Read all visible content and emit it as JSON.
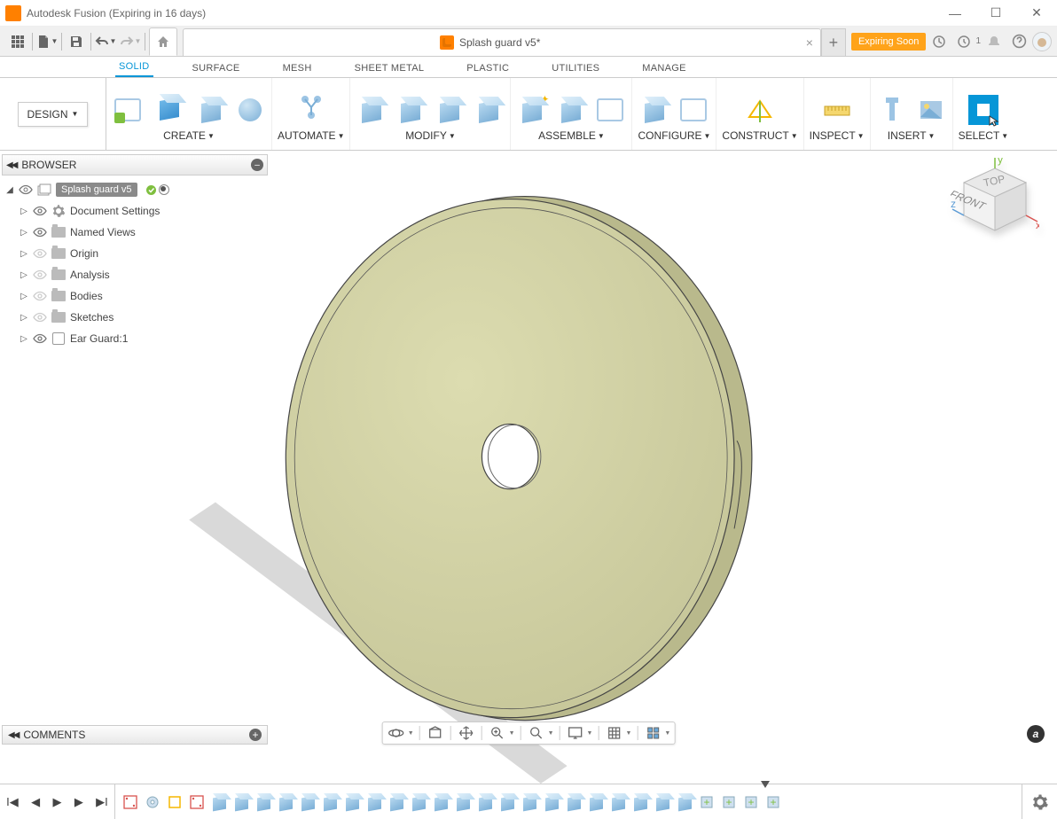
{
  "app": {
    "title": "Autodesk Fusion (Expiring in 16 days)"
  },
  "tabs": {
    "document_name": "Splash guard v5*",
    "expiring_label": "Expiring Soon",
    "job_count": "1"
  },
  "workspace": {
    "button_label": "DESIGN",
    "tabs": [
      "SOLID",
      "SURFACE",
      "MESH",
      "SHEET METAL",
      "PLASTIC",
      "UTILITIES",
      "MANAGE"
    ],
    "active_index": 0
  },
  "ribbon_groups": {
    "create": "CREATE",
    "automate": "AUTOMATE",
    "modify": "MODIFY",
    "assemble": "ASSEMBLE",
    "configure": "CONFIGURE",
    "construct": "CONSTRUCT",
    "inspect": "INSPECT",
    "insert": "INSERT",
    "select": "SELECT"
  },
  "browser": {
    "title": "BROWSER",
    "root": "Splash guard v5",
    "items": [
      {
        "label": "Document Settings",
        "icon": "gear",
        "visible": true
      },
      {
        "label": "Named Views",
        "icon": "folder",
        "visible": true
      },
      {
        "label": "Origin",
        "icon": "folder",
        "visible": false
      },
      {
        "label": "Analysis",
        "icon": "folder",
        "visible": false
      },
      {
        "label": "Bodies",
        "icon": "folder",
        "visible": false
      },
      {
        "label": "Sketches",
        "icon": "folder",
        "visible": false
      },
      {
        "label": "Ear Guard:1",
        "icon": "component",
        "visible": true
      }
    ]
  },
  "comments": {
    "title": "COMMENTS"
  },
  "viewcube": {
    "front": "FRONT",
    "top": "TOP",
    "axes": [
      "x",
      "y",
      "z"
    ]
  },
  "timeline": {
    "item_count": 30
  }
}
